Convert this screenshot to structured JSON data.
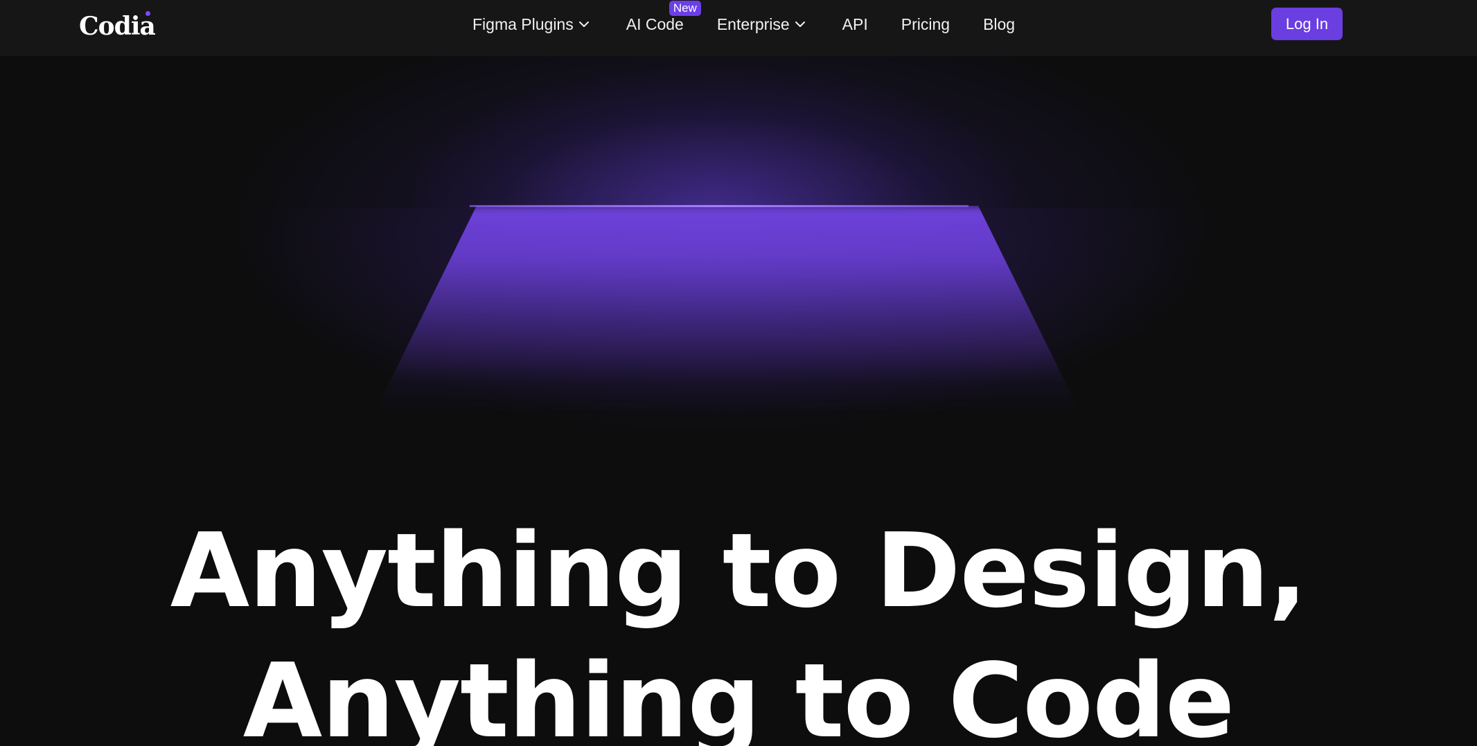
{
  "brand": {
    "name": "Codia",
    "accent": "#6a3ee0"
  },
  "nav": {
    "items": [
      {
        "label": "Figma Plugins",
        "dropdown": true,
        "icon": "chevron-down-icon"
      },
      {
        "label": "AI Code",
        "badge": "New"
      },
      {
        "label": "Enterprise",
        "dropdown": true,
        "icon": "chevron-down-icon"
      },
      {
        "label": "API"
      },
      {
        "label": "Pricing"
      },
      {
        "label": "Blog"
      }
    ],
    "login_label": "Log In"
  },
  "hero": {
    "line1": "Anything to Design,",
    "line2": "Anything to Code"
  }
}
